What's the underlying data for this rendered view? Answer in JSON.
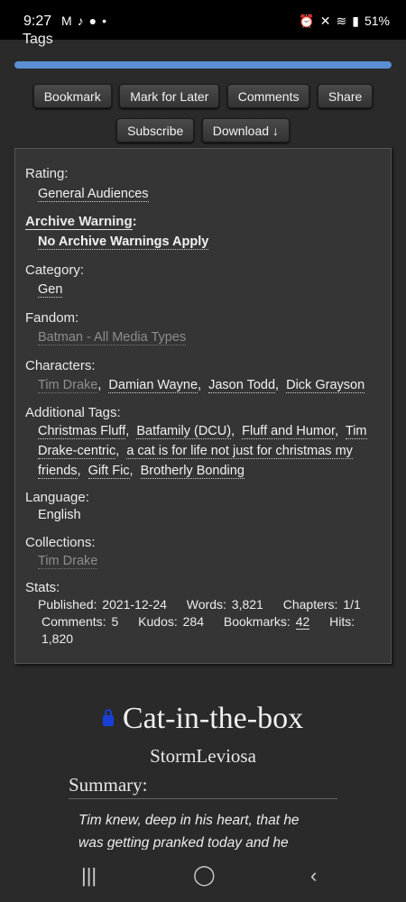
{
  "status": {
    "time": "9:27",
    "battery": "51%"
  },
  "section_heading": "Tags",
  "actions": {
    "bookmark": "Bookmark",
    "mark_for_later": "Mark for Later",
    "comments": "Comments",
    "share": "Share",
    "subscribe": "Subscribe",
    "download": "Download ↓"
  },
  "meta": {
    "rating_label": "Rating:",
    "rating": "General Audiences",
    "warning_label": "Archive Warning",
    "warning": "No Archive Warnings Apply",
    "category_label": "Category:",
    "category": "Gen",
    "fandom_label": "Fandom:",
    "fandom": "Batman - All Media Types",
    "characters_label": "Characters:",
    "characters": [
      "Tim Drake",
      "Damian Wayne",
      "Jason Todd",
      "Dick Grayson"
    ],
    "additional_label": "Additional Tags:",
    "additional": [
      "Christmas Fluff",
      "Batfamily (DCU)",
      "Fluff and Humor",
      "Tim",
      "Drake-centric",
      "a cat is for life not just for christmas my",
      "friends",
      "Gift Fic",
      "Brotherly Bonding"
    ],
    "language_label": "Language:",
    "language": "English",
    "collections_label": "Collections:",
    "collection": "Tim Drake",
    "stats_label": "Stats:",
    "stats": {
      "published_label": "Published:",
      "published": "2021-12-24",
      "words_label": "Words:",
      "words": "3,821",
      "chapters_label": "Chapters:",
      "chapters": "1/1",
      "comments_label": "Comments:",
      "comments": "5",
      "kudos_label": "Kudos:",
      "kudos": "284",
      "bookmarks_label": "Bookmarks:",
      "bookmarks": "42",
      "hits_label": "Hits:",
      "hits": "1,820"
    }
  },
  "work": {
    "title": "Cat-in-the-box",
    "author": "StormLeviosa",
    "summary_heading": "Summary:",
    "summary_line1": "Tim knew, deep in his heart, that he",
    "summary_line2": "was getting pranked today and he"
  },
  "icons": {
    "recents": "recents-icon",
    "home": "home-icon",
    "back": "back-icon"
  }
}
